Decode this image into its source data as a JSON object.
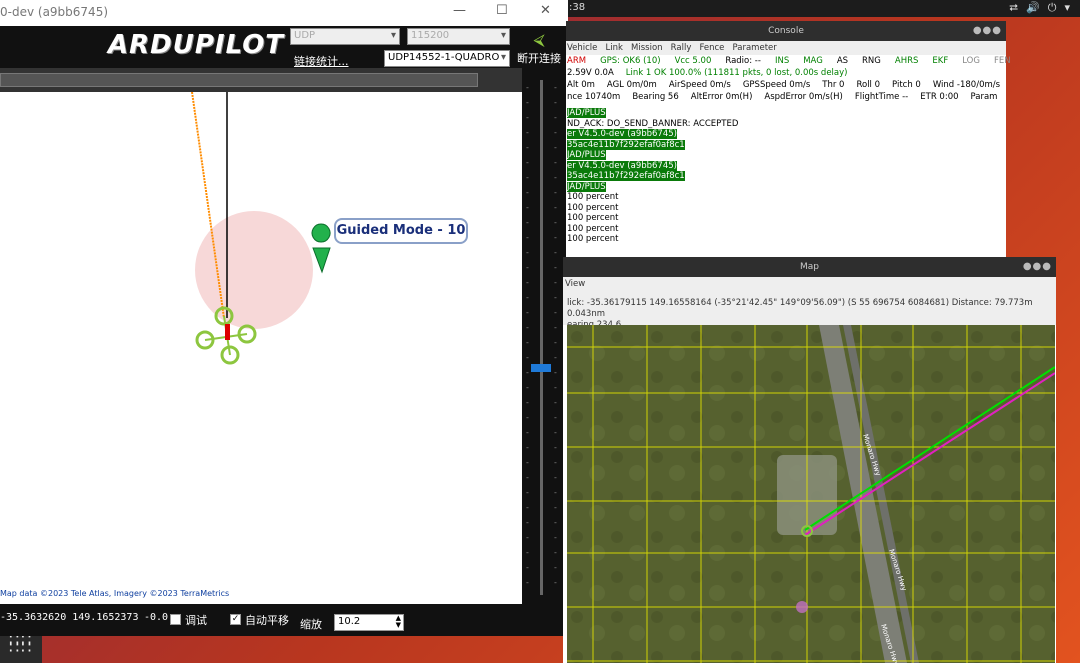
{
  "topbar": {
    "clock": ":38",
    "tray_icons": [
      "network-icon",
      "volume-icon",
      "power-icon"
    ]
  },
  "mission_planner": {
    "title": "0-dev (a9bb6745)",
    "logo_text": "ARDUPILOT",
    "port_select": "UDP",
    "baud_select": "115200",
    "stats_link": "链接统计...",
    "device_select": "UDP14552-1-QUADRO",
    "connect_label": "断开连接",
    "map_callout": "Guided Mode - 10",
    "map_attribution": "Map data ©2023 Tele Atlas, Imagery ©2023 TerraMetrics",
    "status": {
      "position": "-35.3632620 149.1652373",
      "alt_value": "-0.0",
      "debug_label": "调试",
      "autopan_label": "自动平移",
      "zoom_label": "缩放",
      "zoom_value": "10.2"
    }
  },
  "console": {
    "title": "Console",
    "menu": [
      "Vehicle",
      "Link",
      "Mission",
      "Rally",
      "Fence",
      "Parameter"
    ],
    "status_row1": [
      {
        "text": "ARM",
        "color": "#d00000"
      },
      {
        "text": "GPS: OK6 (10)",
        "color": "#008000"
      },
      {
        "text": "Vcc 5.00",
        "color": "#008000"
      },
      {
        "text": "Radio: --",
        "color": "#000000"
      },
      {
        "text": "INS",
        "color": "#008000"
      },
      {
        "text": "MAG",
        "color": "#008000"
      },
      {
        "text": "AS",
        "color": "#000000"
      },
      {
        "text": "RNG",
        "color": "#000000"
      },
      {
        "text": "AHRS",
        "color": "#008000"
      },
      {
        "text": "EKF",
        "color": "#008000"
      },
      {
        "text": "LOG",
        "color": "#888888"
      },
      {
        "text": "FEN",
        "color": "#888888"
      }
    ],
    "status_row2": [
      {
        "text": "2.59V 0.0A",
        "color": "#000000"
      },
      {
        "text": "Link 1 OK 100.0% (111811 pkts, 0 lost, 0.00s delay)",
        "color": "#008000"
      }
    ],
    "status_row3": [
      "Alt 0m",
      "AGL 0m/0m",
      "AirSpeed 0m/s",
      "GPSSpeed 0m/s",
      "Thr 0",
      "Roll 0",
      "Pitch 0",
      "Wind -180/0m/s"
    ],
    "status_row4": [
      "nce 10740m",
      "Bearing 56",
      "AltError 0m(H)",
      "AspdError 0m/s(H)",
      "FlightTime --",
      "ETR 0:00",
      "Param"
    ],
    "log": [
      {
        "text": "JAD/PLUS",
        "hl": true
      },
      {
        "text": "ND_ACK: DO_SEND_BANNER: ACCEPTED",
        "hl": false
      },
      {
        "text": "er V4.5.0-dev (a9bb6745)",
        "hl": true
      },
      {
        "text": "35ac4e11b7f292efaf0af8c1",
        "hl": true
      },
      {
        "text": "JAD/PLUS",
        "hl": true
      },
      {
        "text": "er V4.5.0-dev (a9bb6745)",
        "hl": true
      },
      {
        "text": "35ac4e11b7f292efaf0af8c1",
        "hl": true
      },
      {
        "text": "JAD/PLUS",
        "hl": true
      },
      {
        "text": "100 percent",
        "hl": false
      },
      {
        "text": "100 percent",
        "hl": false
      },
      {
        "text": "100 percent",
        "hl": false
      },
      {
        "text": "100 percent",
        "hl": false
      },
      {
        "text": "100 percent",
        "hl": false
      }
    ]
  },
  "map_window": {
    "title": "Map",
    "menu": "View",
    "info_line1": "lick: -35.36179115 149.16558164 (-35°21'42.45\" 149°09'56.09\") (S 55 696754 6084681)  Distance: 79.773m 0.043nm",
    "info_line2": "earing 234.6",
    "road_labels": [
      "Monaro Hwy",
      "Monaro Hwy",
      "Monaro Hwy"
    ]
  }
}
